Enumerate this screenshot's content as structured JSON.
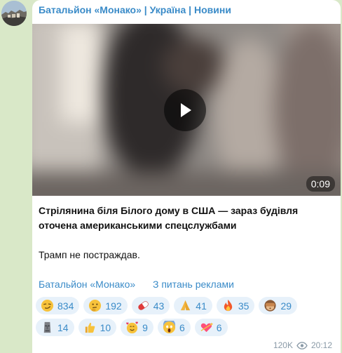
{
  "channel": {
    "name": "Батальйон «Монако» | Україна | Новини"
  },
  "video": {
    "duration": "0:09"
  },
  "message": {
    "title": "Стрілянина біля Білого дому в США — зараз будівля оточена американськими спецслужбами",
    "body": "Трамп не постраждав."
  },
  "links": {
    "channel": "Батальйон «Монако»",
    "ads": "З питань реклами"
  },
  "reactions": [
    {
      "icon": "smirk-face-icon",
      "count": "834"
    },
    {
      "icon": "thinking-face-icon",
      "count": "192"
    },
    {
      "icon": "pill-icon",
      "count": "43"
    },
    {
      "icon": "folded-hands-icon",
      "count": "41"
    },
    {
      "icon": "fire-icon",
      "count": "35"
    },
    {
      "icon": "see-no-evil-monkey-icon",
      "count": "29"
    },
    {
      "icon": "moai-icon",
      "count": "14"
    },
    {
      "icon": "thumbs-up-icon",
      "count": "10"
    },
    {
      "icon": "smiling-face-with-hearts-icon",
      "count": "9"
    },
    {
      "icon": "screaming-face-icon",
      "count": "6"
    },
    {
      "icon": "heart-with-arrow-icon",
      "count": "6"
    }
  ],
  "footer": {
    "views": "120K",
    "time": "20:12"
  },
  "colors": {
    "accent": "#3a8bc8",
    "background": "#d9e8c8",
    "reaction_bg": "#e7f1fa"
  }
}
